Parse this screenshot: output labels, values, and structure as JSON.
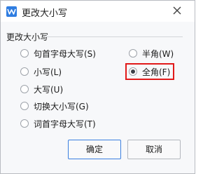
{
  "dialog": {
    "title": "更改大小写",
    "app_icon": "wps-writer-icon",
    "close_icon": "close-icon"
  },
  "group": {
    "title": "更改大小写",
    "options_left": [
      {
        "label": "句首字母大写(S)",
        "checked": false
      },
      {
        "label": "小写(L)",
        "checked": false
      },
      {
        "label": "大写(U)",
        "checked": false
      },
      {
        "label": "切换大小写(G)",
        "checked": false
      },
      {
        "label": "词首字母大写(T)",
        "checked": false
      }
    ],
    "options_right": [
      {
        "label": "半角(W)",
        "checked": false
      },
      {
        "label": "全角(F)",
        "checked": true
      }
    ]
  },
  "buttons": {
    "ok": "确定",
    "cancel": "取消"
  },
  "colors": {
    "highlight": "#e11a1a",
    "primary_border": "#3b7fe0",
    "icon_blue": "#2f7de1"
  }
}
